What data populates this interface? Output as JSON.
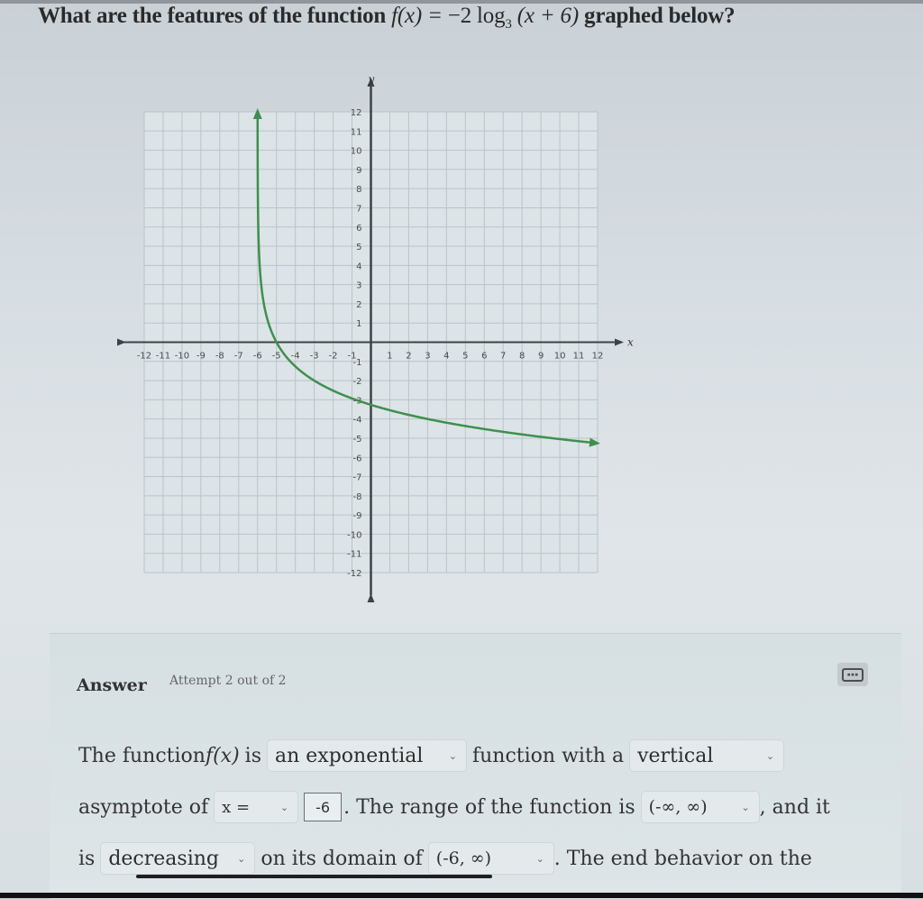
{
  "question": {
    "prefix": "What are the features of the function ",
    "function_lhs": "f(x) = ",
    "function_rhs_coef": "−2 log",
    "log_base": "3",
    "function_arg": " (x + 6)",
    "suffix": " graphed below?"
  },
  "chart_data": {
    "type": "line",
    "title": "",
    "xlabel": "x",
    "ylabel": "y",
    "xlim": [
      -12,
      12
    ],
    "ylim": [
      -12,
      12
    ],
    "grid": true,
    "x_ticks": [
      -12,
      -11,
      -10,
      -9,
      -8,
      -7,
      -6,
      -5,
      -4,
      -3,
      -2,
      -1,
      1,
      2,
      3,
      4,
      5,
      6,
      7,
      8,
      9,
      10,
      11,
      12
    ],
    "y_ticks": [
      -12,
      -11,
      -10,
      -9,
      -8,
      -7,
      -6,
      -5,
      -4,
      -3,
      -2,
      -1,
      1,
      2,
      3,
      4,
      5,
      6,
      7,
      8,
      9,
      10,
      11,
      12
    ],
    "series": [
      {
        "name": "f(x) = -2 log3(x + 6)",
        "color": "#3f8f4e",
        "function": "-2*log3(x+6)",
        "x_start": -5.9987,
        "x_end": 12,
        "key_points": [
          [
            -5,
            0
          ],
          [
            -3,
            -2
          ],
          [
            3,
            -4
          ]
        ],
        "arrow_ends": [
          "top",
          "right"
        ]
      }
    ],
    "asymptote": {
      "type": "vertical",
      "x": -6,
      "drawn": false
    }
  },
  "answer": {
    "title": "Answer",
    "attempt": "Attempt 2 out of 2",
    "keypad_icon": "keyboard-icon",
    "line1": {
      "t1": "The function ",
      "math": "f(x)",
      "t2": " is",
      "select_type": "an exponential",
      "t3": "function with a",
      "select_asymptote_kind": "vertical"
    },
    "line2": {
      "t1": "asymptote of",
      "select_variable": "x =",
      "asymptote_value": "-6",
      "t2": ". The range of the function is",
      "select_range": "(-∞, ∞)",
      "t3": ", and it"
    },
    "line3": {
      "t1": "is",
      "select_monotonic": "decreasing",
      "t2": "on its domain of",
      "select_domain": "(-6, ∞)",
      "t3": ". The end behavior on the"
    },
    "chevron": "⌄"
  }
}
